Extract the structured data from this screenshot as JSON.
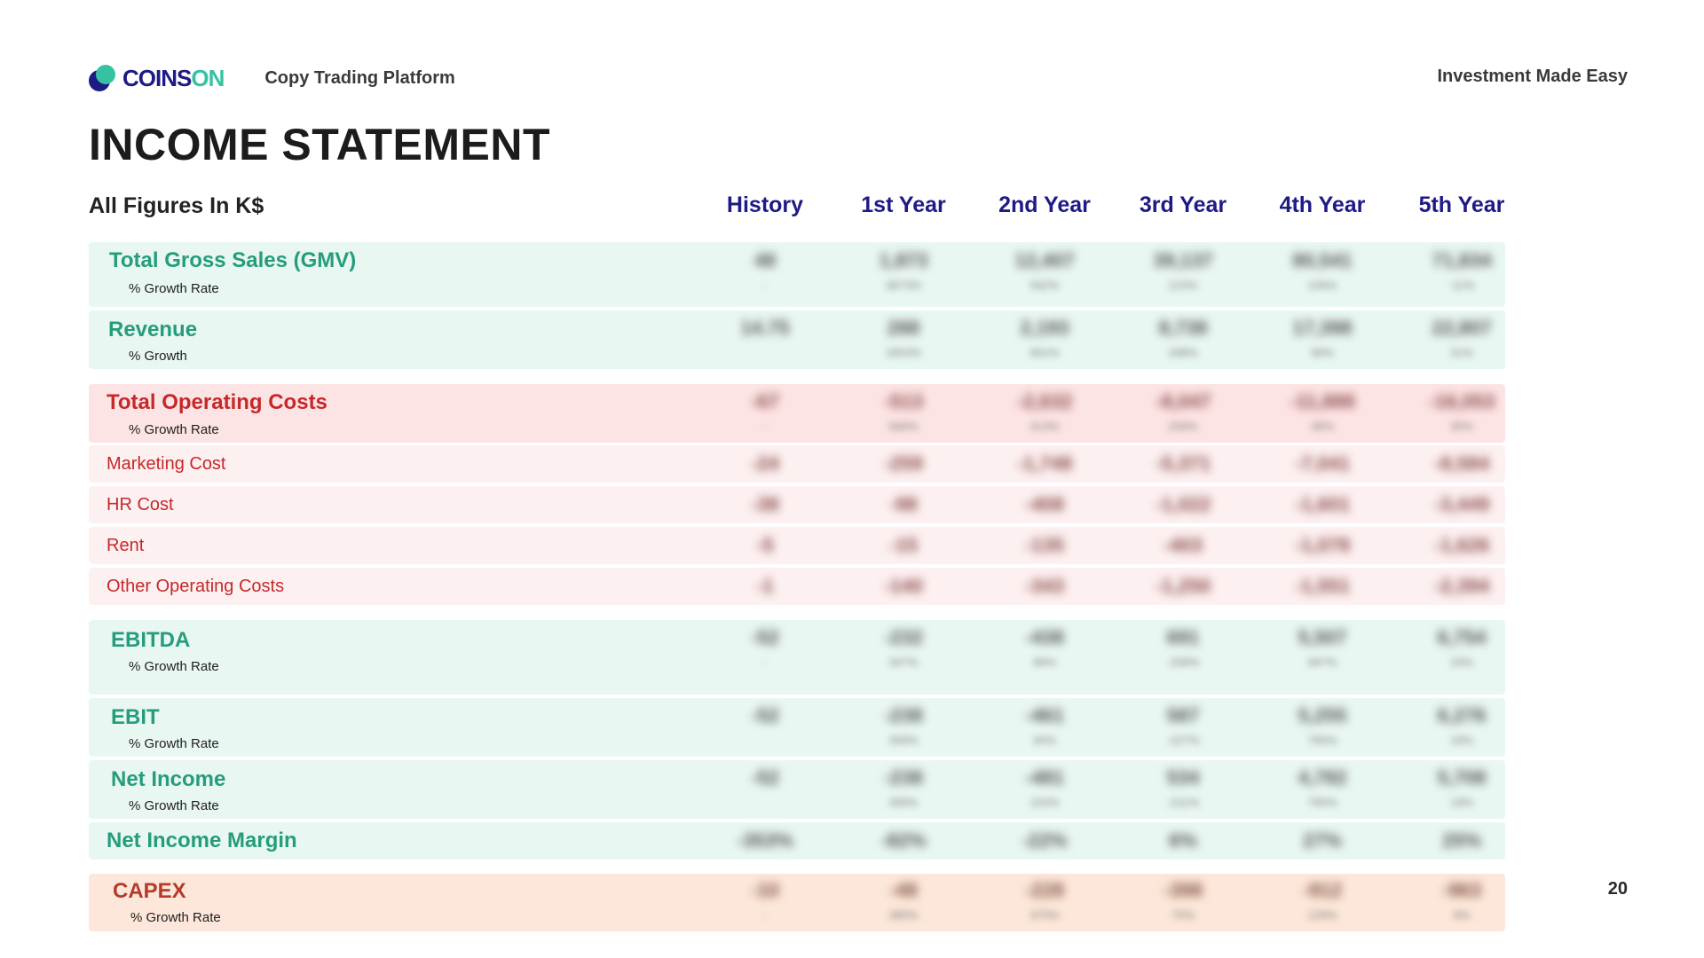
{
  "header": {
    "logo_word1": "COINS",
    "logo_word2": "ON",
    "tagline": "Copy Trading Platform",
    "motto": "Investment Made Easy"
  },
  "title": "INCOME STATEMENT",
  "units": "All Figures In K$",
  "columns": [
    "History",
    "1st Year",
    "2nd Year",
    "3rd Year",
    "4th Year",
    "5th Year"
  ],
  "colors": {
    "brand_navy": "#1e1a86",
    "brand_teal": "#35c2a3",
    "green_text": "#259d7c",
    "red_text": "#c6282b",
    "green_bg": "#e9f7f3",
    "red_bg": "#fde4e4",
    "pink_bg": "#fdf0f0",
    "orange_bg": "#fde7da"
  },
  "rows": [
    {
      "label": "Total Gross Sales (GMV)",
      "sublabel": "% Growth Rate",
      "values": [
        "48",
        "1,873",
        "12,407",
        "39,137",
        "80,541",
        "71,834"
      ],
      "growth": [
        "-",
        "3873%",
        "562%",
        "215%",
        "106%",
        "-11%"
      ]
    },
    {
      "label": "Revenue",
      "sublabel": "% Growth",
      "values": [
        "14.75",
        "288",
        "2,193",
        "8,738",
        "17,398",
        "22,807"
      ],
      "growth": [
        "",
        "1853%",
        "661%",
        "298%",
        "99%",
        "31%"
      ]
    },
    {
      "label": "Total Operating Costs",
      "sublabel": "% Growth Rate",
      "values": [
        "-67",
        "-513",
        "-2,632",
        "-8,047",
        "-11,888",
        "-16,053"
      ],
      "growth": [
        "-",
        "666%",
        "413%",
        "206%",
        "48%",
        "35%"
      ]
    },
    {
      "label": "Marketing Cost",
      "values": [
        "-24",
        "-259",
        "-1,748",
        "-5,371",
        "-7,041",
        "-8,584"
      ]
    },
    {
      "label": "HR Cost",
      "values": [
        "-38",
        "-98",
        "-408",
        "-1,022",
        "-1,601",
        "-3,449"
      ]
    },
    {
      "label": "Rent",
      "values": [
        "-5",
        "-15",
        "-135",
        "-403",
        "-1,078",
        "-1,626"
      ]
    },
    {
      "label": "Other Operating Costs",
      "values": [
        "-1",
        "-140",
        "-343",
        "-1,250",
        "-1,551",
        "-2,394"
      ]
    },
    {
      "label": "EBITDA",
      "sublabel": "% Growth Rate",
      "values": [
        "-52",
        "-232",
        "-438",
        "691",
        "5,507",
        "6,754"
      ],
      "growth": [
        "-",
        "347%",
        "89%",
        "-258%",
        "697%",
        "23%"
      ]
    },
    {
      "label": "EBIT",
      "sublabel": "% Growth Rate",
      "values": [
        "-52",
        "-238",
        "-461",
        "587",
        "5,255",
        "6,276"
      ],
      "growth": [
        "",
        "358%",
        "94%",
        "-227%",
        "795%",
        "19%"
      ]
    },
    {
      "label": "Net Income",
      "sublabel": "% Growth Rate",
      "values": [
        "-52",
        "-238",
        "-481",
        "534",
        "4,782",
        "5,708"
      ],
      "growth": [
        "",
        "358%",
        "102%",
        "-211%",
        "795%",
        "19%"
      ]
    },
    {
      "label": "Net Income Margin",
      "values": [
        "-353%",
        "-82%",
        "-22%",
        "6%",
        "27%",
        "25%"
      ]
    },
    {
      "label": "CAPEX",
      "sublabel": "% Growth Rate",
      "values": [
        "-10",
        "-48",
        "-228",
        "-398",
        "-912",
        "-963"
      ],
      "growth": [
        "-",
        "380%",
        "375%",
        "75%",
        "129%",
        "6%"
      ]
    }
  ],
  "page_number": "20"
}
